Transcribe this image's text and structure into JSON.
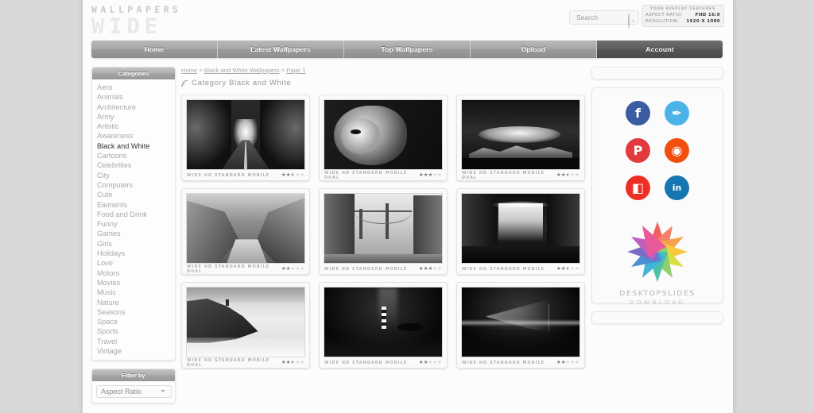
{
  "site": {
    "logo_top": "WALLPAPERS",
    "logo_bottom": "WIDE"
  },
  "search": {
    "placeholder": "Search",
    "value": "",
    "icon": "search-icon"
  },
  "display_features": {
    "title": "YOUR DISPLAY FEATURES",
    "aspect_ratio_label": "ASPECT RATIO:",
    "aspect_ratio_value": "FHD 16:9",
    "resolution_label": "RESOLUTION:",
    "resolution_value": "1920 X 1080"
  },
  "nav": {
    "items": [
      {
        "label": "Home",
        "active": false
      },
      {
        "label": "Latest Wallpapers",
        "active": false
      },
      {
        "label": "Top Wallpapers",
        "active": false
      },
      {
        "label": "Upload",
        "active": false
      },
      {
        "label": "Account",
        "active": true
      }
    ]
  },
  "sidebar": {
    "categories_header": "Categories",
    "categories": [
      {
        "label": "Aero",
        "active": false
      },
      {
        "label": "Animals",
        "active": false
      },
      {
        "label": "Architecture",
        "active": false
      },
      {
        "label": "Army",
        "active": false
      },
      {
        "label": "Artistic",
        "active": false
      },
      {
        "label": "Awareness",
        "active": false
      },
      {
        "label": "Black and White",
        "active": true
      },
      {
        "label": "Cartoons",
        "active": false
      },
      {
        "label": "Celebrities",
        "active": false
      },
      {
        "label": "City",
        "active": false
      },
      {
        "label": "Computers",
        "active": false
      },
      {
        "label": "Cute",
        "active": false
      },
      {
        "label": "Elements",
        "active": false
      },
      {
        "label": "Food and Drink",
        "active": false
      },
      {
        "label": "Funny",
        "active": false
      },
      {
        "label": "Games",
        "active": false
      },
      {
        "label": "Girls",
        "active": false
      },
      {
        "label": "Holidays",
        "active": false
      },
      {
        "label": "Love",
        "active": false
      },
      {
        "label": "Motors",
        "active": false
      },
      {
        "label": "Movies",
        "active": false
      },
      {
        "label": "Music",
        "active": false
      },
      {
        "label": "Nature",
        "active": false
      },
      {
        "label": "Seasons",
        "active": false
      },
      {
        "label": "Space",
        "active": false
      },
      {
        "label": "Sports",
        "active": false
      },
      {
        "label": "Travel",
        "active": false
      },
      {
        "label": "Vintage",
        "active": false
      }
    ],
    "filter_header": "Filter by",
    "filter_selected": "Aspect Ratio"
  },
  "breadcrumb": {
    "home": "Home",
    "sep1": " > ",
    "category": "Black and White Wallpapers",
    "sep2": " > ",
    "page": "Page 1"
  },
  "content": {
    "category_title": "Category Black and White",
    "rss_icon": "rss-icon"
  },
  "thumbnails": [
    {
      "alt": "tree tunnel road",
      "tags": "WIDE HD STANDARD MOBILE",
      "rating": 2.5
    },
    {
      "alt": "lion portrait",
      "tags": "WIDE HD STANDARD MOBILE DUAL",
      "rating": 3
    },
    {
      "alt": "mountain ridge with clouds",
      "tags": "WIDE HD STANDARD MOBILE DUAL",
      "rating": 2.5
    },
    {
      "alt": "canyon rock formation",
      "tags": "WIDE HD STANDARD MOBILE DUAL",
      "rating": 2
    },
    {
      "alt": "bay bridge city street",
      "tags": "WIDE HD STANDARD MOBILE",
      "rating": 3
    },
    {
      "alt": "waterfall long exposure",
      "tags": "WIDE HD STANDARD MOBILE",
      "rating": 2.5
    },
    {
      "alt": "coastline lighthouse",
      "tags": "WIDE HD STANDARD MOBILE DUAL",
      "rating": 2.5
    },
    {
      "alt": "night lighthouse milky way",
      "tags": "WIDE HD STANDARD MOBILE",
      "rating": 2
    },
    {
      "alt": "pier under milky way",
      "tags": "WIDE HD STANDARD MOBILE",
      "rating": 2
    }
  ],
  "social": [
    {
      "name": "facebook",
      "glyph": "f",
      "color": "#3b5ca0"
    },
    {
      "name": "twitter",
      "glyph": "✒",
      "color": "#4cb3e8"
    },
    {
      "name": "pinterest",
      "glyph": "P",
      "color": "#e23a3e"
    },
    {
      "name": "reddit",
      "glyph": "◉",
      "color": "#f24e0e"
    },
    {
      "name": "flipboard",
      "glyph": "◧",
      "color": "#ee2e24"
    },
    {
      "name": "linkedin",
      "glyph": "in",
      "color": "#1576b2"
    }
  ],
  "promo": {
    "name": "DESKTOPSLIDES",
    "subtitle": "DOWNLOAD",
    "colors": [
      "#f06060",
      "#f2806a",
      "#f6a14e",
      "#f8c93f",
      "#d9df47",
      "#8fd06a",
      "#4fc0a8",
      "#3fb4d8",
      "#4a8fd4",
      "#7a6ec6",
      "#c05fc0",
      "#e8589a"
    ]
  }
}
